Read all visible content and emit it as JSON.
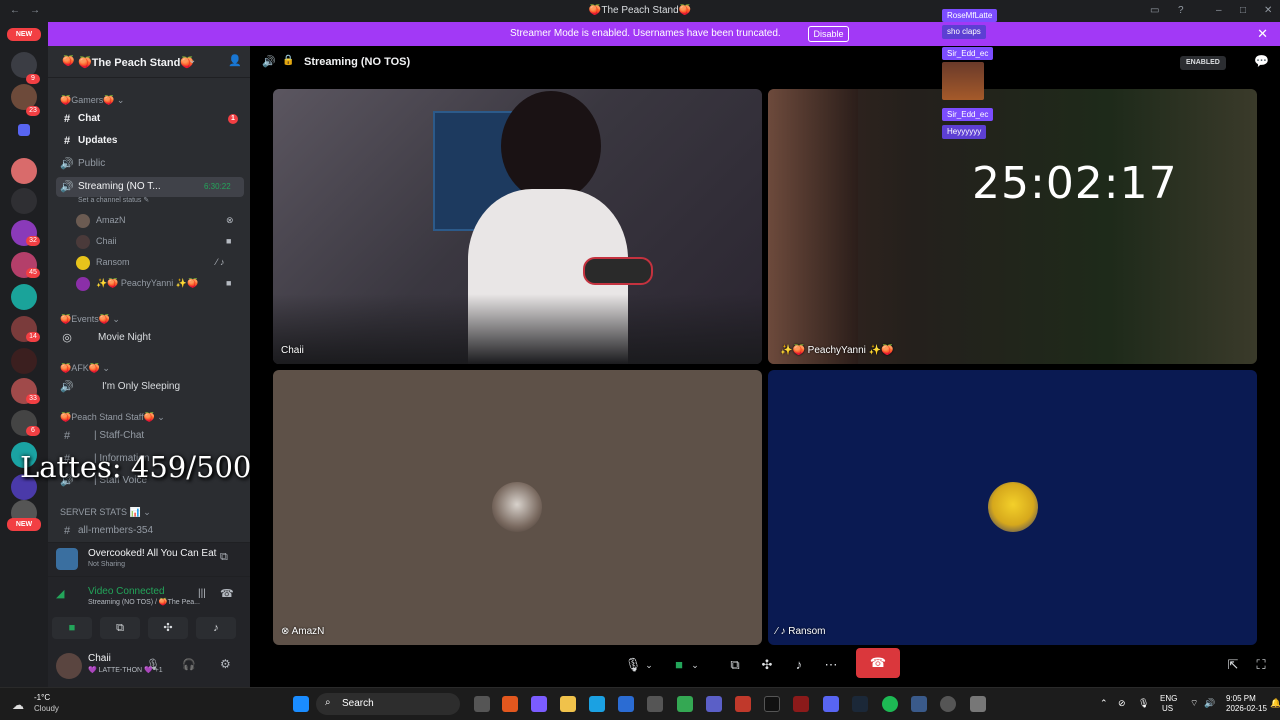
{
  "window": {
    "title": "🍑The Peach Stand🍑",
    "nav_back": "←",
    "nav_forward": "→"
  },
  "banner": {
    "message": "Streamer Mode is enabled. Usernames have been truncated.",
    "button": "Disable",
    "close": "✕"
  },
  "rail": {
    "new_label": "NEW",
    "badges": [
      "9",
      "23",
      "32",
      "45",
      "14",
      "33",
      "6"
    ]
  },
  "server": {
    "name": "🍑The Peach Stand🍑",
    "categories": [
      {
        "label": "🍑Gamers🍑 ⌄"
      },
      {
        "label": "🍑Events🍑 ⌄"
      },
      {
        "label": "🍑AFK🍑 ⌄"
      },
      {
        "label": "🍑Peach Stand Staff🍑 ⌄"
      },
      {
        "label": "SERVER STATS 📊 ⌄"
      }
    ],
    "channels": {
      "chat": "Chat",
      "chat_badge": "1",
      "updates": "Updates",
      "public": "Public",
      "streaming": "Streaming (NO T...",
      "streaming_time": "6:30:22",
      "streaming_status": "Set a channel status ✎",
      "movie_night": "Movie Night",
      "sleeping": "I'm Only Sleeping",
      "staff_chat": "| Staff-Chat",
      "information": "| Information",
      "staff_voice": "| Staff Voice",
      "all_members": "all-members-354"
    },
    "voice_users": [
      "AmazN",
      "Chaii",
      "Ransom",
      "✨🍑 PeachyYanni ✨🍑"
    ]
  },
  "activity": {
    "title": "Overcooked! All You Can Eat",
    "subtitle": "Not Sharing"
  },
  "voice": {
    "status": "Video Connected",
    "channel": "Streaming (NO TOS) / 🍑The Pea..."
  },
  "user_panel": {
    "name": "Chaii",
    "status": "💜 LATTE-THON 💜 +1"
  },
  "channel_header": {
    "name": "Streaming (NO TOS)",
    "enabled": "ENABLED"
  },
  "tiles": {
    "chaii": "Chaii",
    "peachy": "✨🍑 PeachyYanni ✨🍑",
    "amazn": "AmazN",
    "ransom": "Ransom"
  },
  "overlay": {
    "lattes": "Lattes: 459/500",
    "timer": "25:02:17",
    "chat": [
      {
        "user": "RoseMfLatte",
        "msg": "sho claps"
      },
      {
        "user": "Sir_Edd_ec",
        "msg": ""
      },
      {
        "user": "Sir_Edd_ec",
        "msg": "Heyyyyyy"
      }
    ]
  },
  "taskbar": {
    "weather_temp": "-1°C",
    "weather_desc": "Cloudy",
    "search": "Search",
    "lang": "ENG",
    "region": "US",
    "time": "9:05 PM",
    "date": "2026-02-15"
  },
  "colors": {
    "banner": "#a239f6",
    "hangup": "#da373c",
    "ping": "#f23f43",
    "video_green": "#23a55a"
  }
}
